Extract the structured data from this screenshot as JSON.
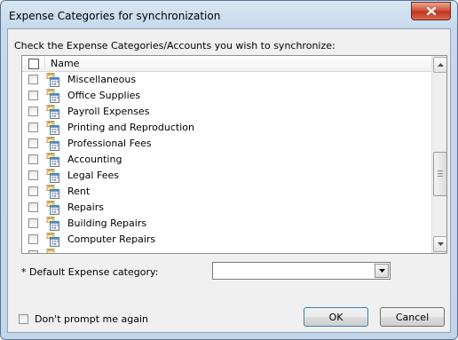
{
  "window": {
    "title": "Expense Categories for synchronization"
  },
  "instruction": "Check the Expense Categories/Accounts you wish to synchronize:",
  "list": {
    "header": {
      "name": "Name"
    },
    "items": [
      {
        "label": "Miscellaneous",
        "checked": false
      },
      {
        "label": "Office Supplies",
        "checked": false
      },
      {
        "label": "Payroll Expenses",
        "checked": false
      },
      {
        "label": "Printing and Reproduction",
        "checked": false
      },
      {
        "label": "Professional Fees",
        "checked": false
      },
      {
        "label": "Accounting",
        "checked": false
      },
      {
        "label": "Legal Fees",
        "checked": false
      },
      {
        "label": "Rent",
        "checked": false
      },
      {
        "label": "Repairs",
        "checked": false
      },
      {
        "label": "Building Repairs",
        "checked": false
      },
      {
        "label": "Computer Repairs",
        "checked": false
      }
    ]
  },
  "default_category": {
    "label": "* Default Expense category:",
    "value": ""
  },
  "dont_prompt": {
    "label": "Don't prompt me again",
    "checked": false
  },
  "buttons": {
    "ok": "OK",
    "cancel": "Cancel"
  }
}
